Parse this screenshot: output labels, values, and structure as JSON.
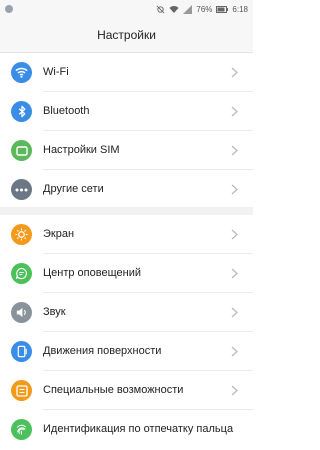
{
  "status_bar": {
    "battery": "76%",
    "time": "6:18"
  },
  "header": {
    "title": "Настройки"
  },
  "section1": [
    {
      "label": "Wi-Fi",
      "icon": "wifi-icon",
      "color": "#3a8de6"
    },
    {
      "label": "Bluetooth",
      "icon": "bluetooth-icon",
      "color": "#3a8de6"
    },
    {
      "label": "Настройки SIM",
      "icon": "sim-icon",
      "color": "#5cb85c"
    },
    {
      "label": "Другие сети",
      "icon": "more-icon",
      "color": "#6b7785"
    }
  ],
  "section2": [
    {
      "label": "Экран",
      "icon": "brightness-icon",
      "color": "#f39a1b"
    },
    {
      "label": "Центр оповещений",
      "icon": "notification-icon",
      "color": "#4cc05a"
    },
    {
      "label": "Звук",
      "icon": "sound-icon",
      "color": "#8a929b"
    },
    {
      "label": "Движения поверхности",
      "icon": "gesture-icon",
      "color": "#3a8de6"
    },
    {
      "label": "Специальные возможности",
      "icon": "accessibility-icon",
      "color": "#f39a1b"
    },
    {
      "label": "Идентификация по отпечатку пальца",
      "icon": "fingerprint-icon",
      "color": "#4cc05a"
    }
  ]
}
